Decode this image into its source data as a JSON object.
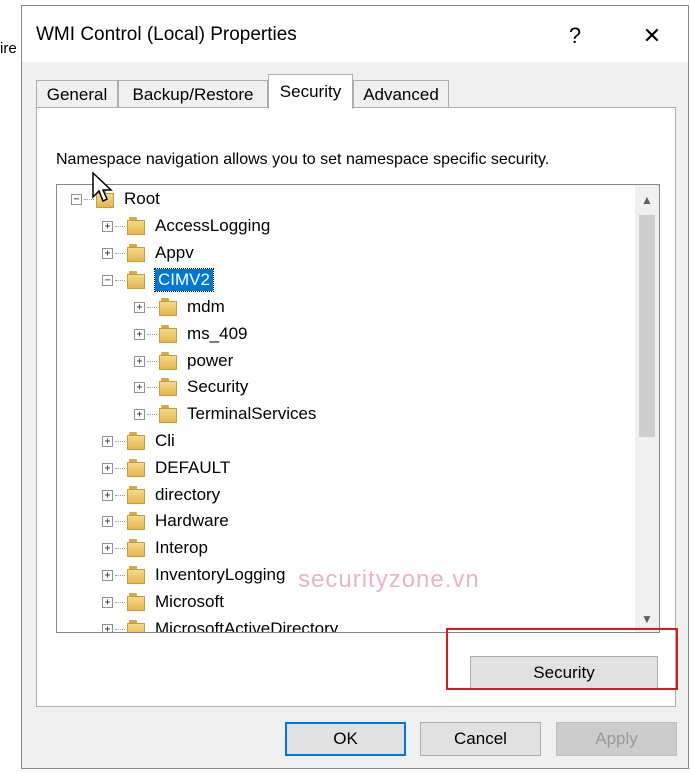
{
  "background_fragment": "ire",
  "window": {
    "title": "WMI Control (Local) Properties",
    "help_label": "?",
    "close_label": "✕"
  },
  "tabs": [
    {
      "label": "General"
    },
    {
      "label": "Backup/Restore"
    },
    {
      "label": "Security",
      "active": true
    },
    {
      "label": "Advanced"
    }
  ],
  "description": "Namespace navigation allows you to set namespace specific security.",
  "tree": {
    "root": "Root",
    "items": [
      {
        "label": "AccessLogging"
      },
      {
        "label": "Appv"
      },
      {
        "label": "CIMV2",
        "selected": true,
        "expanded": true
      },
      {
        "label": "mdm"
      },
      {
        "label": "ms_409"
      },
      {
        "label": "power"
      },
      {
        "label": "Security"
      },
      {
        "label": "TerminalServices"
      },
      {
        "label": "Cli"
      },
      {
        "label": "DEFAULT"
      },
      {
        "label": "directory"
      },
      {
        "label": "Hardware"
      },
      {
        "label": "Interop"
      },
      {
        "label": "InventoryLogging"
      },
      {
        "label": "Microsoft"
      },
      {
        "label": "MicrosoftActiveDirectory"
      }
    ]
  },
  "buttons": {
    "security": "Security",
    "ok": "OK",
    "cancel": "Cancel",
    "apply": "Apply"
  },
  "watermark": "securityzone.vn",
  "colors": {
    "selection": "#0078d7",
    "highlight_frame": "#d61c23",
    "dialog_bg": "#f0f0f0"
  }
}
